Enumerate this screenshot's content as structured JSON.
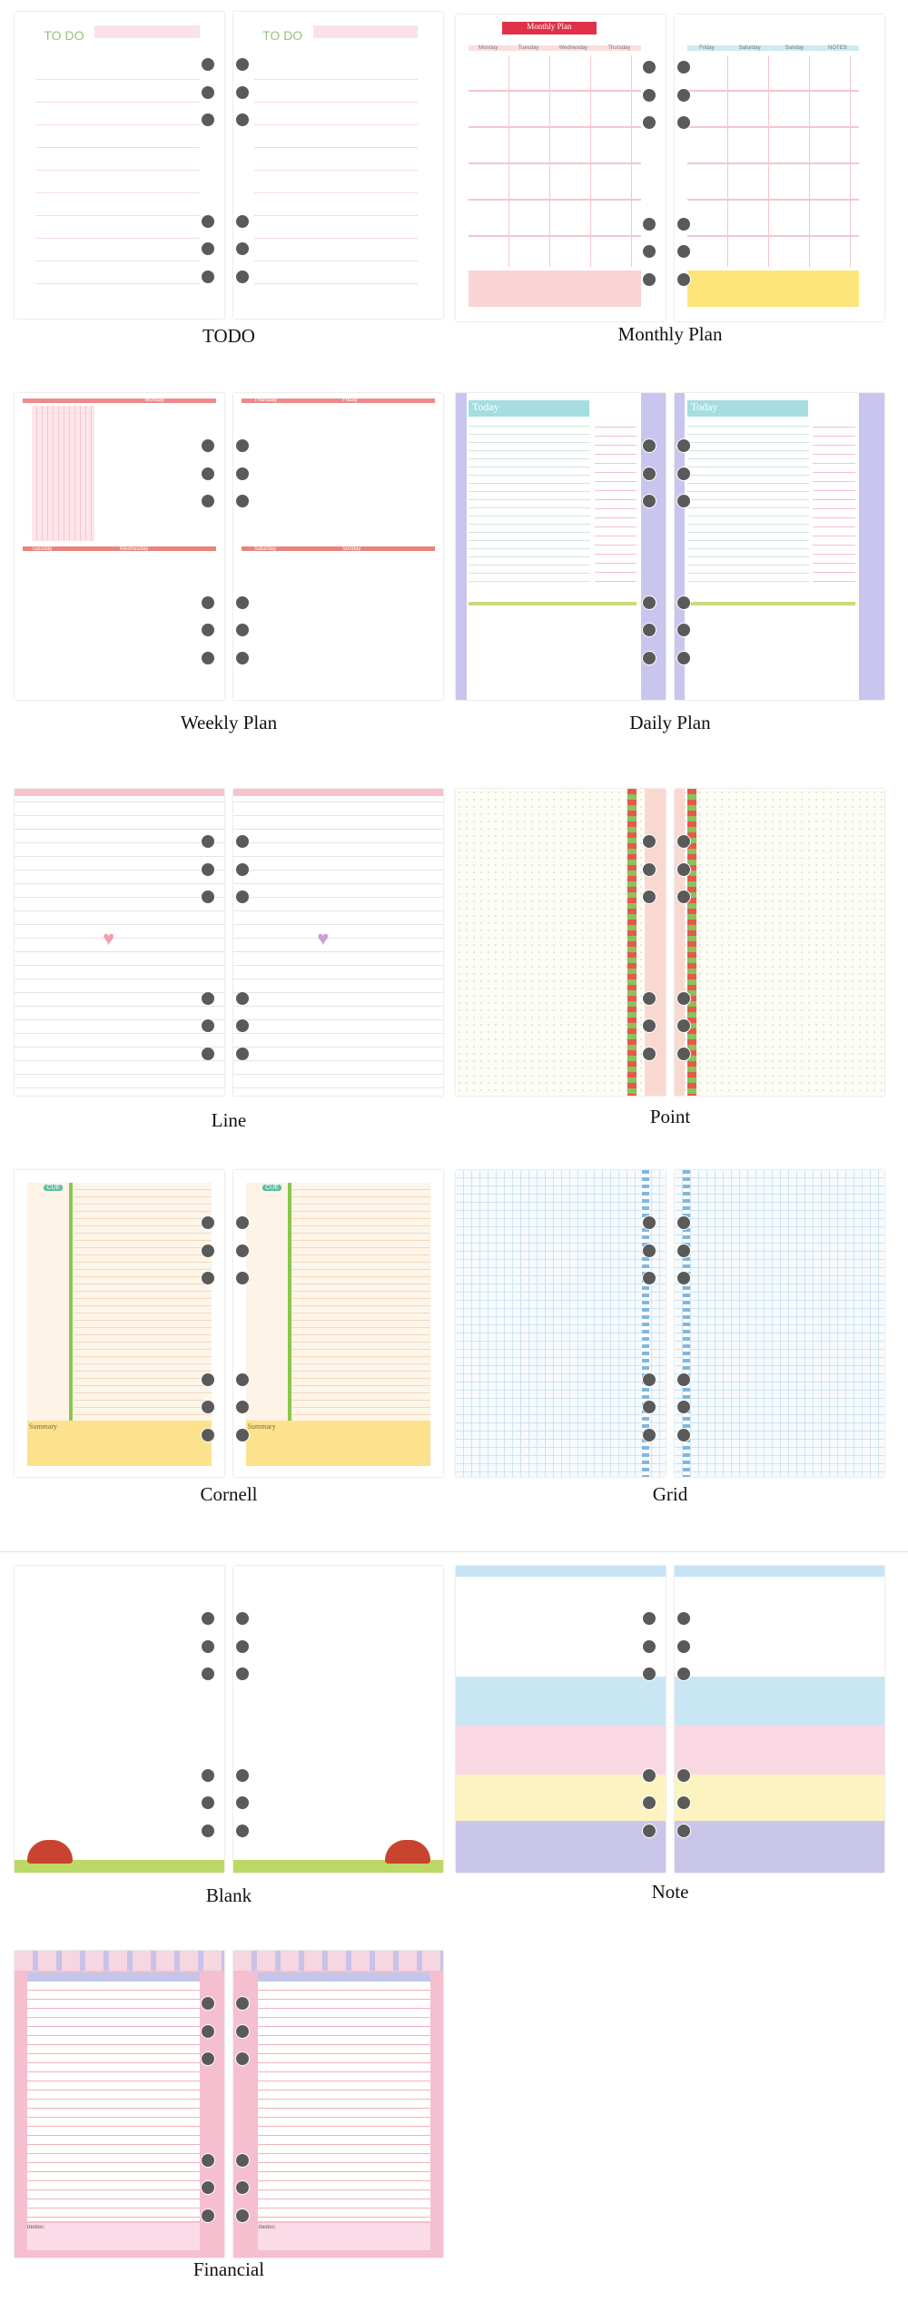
{
  "panels": [
    {
      "id": "todo",
      "caption": "TODO",
      "labels": {
        "title": "TO DO"
      }
    },
    {
      "id": "monthly",
      "caption": "Monthly Plan",
      "labels": {
        "banner": "Monthly Plan",
        "days_left": [
          "Monday",
          "Tuesday",
          "Wednesday",
          "Thursday"
        ],
        "days_right": [
          "Friday",
          "Saturday",
          "Sunday",
          "NOTES"
        ]
      }
    },
    {
      "id": "weekly",
      "caption": "Weekly Plan",
      "labels": {
        "days": [
          "Monday",
          "Tuesday",
          "Wednesday",
          "Thursday",
          "Friday",
          "Saturday",
          "Sunday"
        ]
      }
    },
    {
      "id": "daily",
      "caption": "Daily Plan",
      "labels": {
        "title": "Today"
      }
    },
    {
      "id": "line",
      "caption": "Line"
    },
    {
      "id": "point",
      "caption": "Point"
    },
    {
      "id": "cornell",
      "caption": "Cornell",
      "labels": {
        "cue": "CUE",
        "summary": "Summary"
      }
    },
    {
      "id": "grid",
      "caption": "Grid"
    },
    {
      "id": "blank",
      "caption": "Blank"
    },
    {
      "id": "note",
      "caption": "Note"
    },
    {
      "id": "financial",
      "caption": "Financial",
      "labels": {
        "memo": "memo:"
      }
    }
  ],
  "colors": {
    "hole": "#5a5a5a",
    "pink": "#f5bfd0",
    "todo_green": "#9bbf7a",
    "monthly_red": "#e0304a"
  }
}
